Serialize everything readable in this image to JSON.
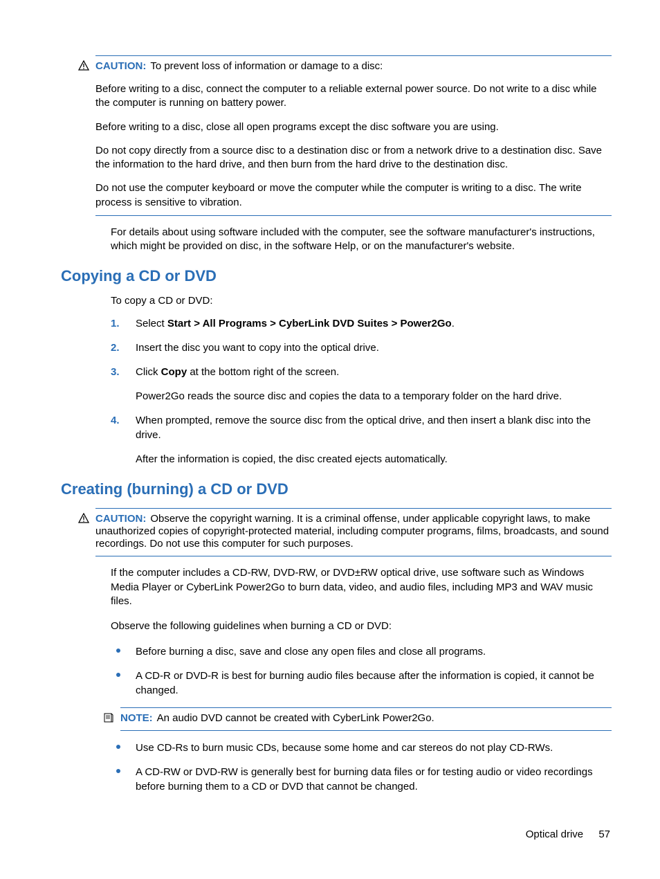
{
  "caution1": {
    "label": "CAUTION:",
    "lead": "To prevent loss of information or damage to a disc:",
    "p1": "Before writing to a disc, connect the computer to a reliable external power source. Do not write to a disc while the computer is running on battery power.",
    "p2": "Before writing to a disc, close all open programs except the disc software you are using.",
    "p3": "Do not copy directly from a source disc to a destination disc or from a network drive to a destination disc. Save the information to the hard drive, and then burn from the hard drive to the destination disc.",
    "p4": "Do not use the computer keyboard or move the computer while the computer is writing to a disc. The write process is sensitive to vibration."
  },
  "after_caution1": "For details about using software included with the computer, see the software manufacturer's instructions, which might be provided on disc, in the software Help, or on the manufacturer's website.",
  "section1": {
    "title": "Copying a CD or DVD",
    "intro": "To copy a CD or DVD:",
    "steps": [
      {
        "n": "1.",
        "pre": "Select ",
        "bold": "Start > All Programs > CyberLink DVD Suites > Power2Go",
        "post": "."
      },
      {
        "n": "2.",
        "text": "Insert the disc you want to copy into the optical drive."
      },
      {
        "n": "3.",
        "pre": "Click ",
        "bold": "Copy",
        "post": " at the bottom right of the screen.",
        "sub": "Power2Go reads the source disc and copies the data to a temporary folder on the hard drive."
      },
      {
        "n": "4.",
        "text": "When prompted, remove the source disc from the optical drive, and then insert a blank disc into the drive.",
        "sub": "After the information is copied, the disc created ejects automatically."
      }
    ]
  },
  "section2": {
    "title": "Creating (burning) a CD or DVD",
    "caution": {
      "label": "CAUTION:",
      "text": "Observe the copyright warning. It is a criminal offense, under applicable copyright laws, to make unauthorized copies of copyright-protected material, including computer programs, films, broadcasts, and sound recordings. Do not use this computer for such purposes."
    },
    "p1": "If the computer includes a CD-RW, DVD-RW, or DVD±RW optical drive, use software such as Windows Media Player or CyberLink Power2Go to burn data, video, and audio files, including MP3 and WAV music files.",
    "p2": "Observe the following guidelines when burning a CD or DVD:",
    "bullets": [
      "Before burning a disc, save and close any open files and close all programs.",
      "A CD-R or DVD-R is best for burning audio files because after the information is copied, it cannot be changed."
    ],
    "note": {
      "label": "NOTE:",
      "text": "An audio DVD cannot be created with CyberLink Power2Go."
    },
    "bullets2": [
      "Use CD-Rs to burn music CDs, because some home and car stereos do not play CD-RWs.",
      "A CD-RW or DVD-RW is generally best for burning data files or for testing audio or video recordings before burning them to a CD or DVD that cannot be changed."
    ]
  },
  "footer": {
    "section": "Optical drive",
    "page": "57"
  }
}
